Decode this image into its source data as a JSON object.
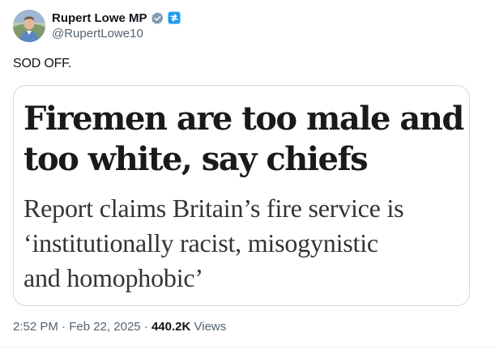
{
  "author": {
    "name": "Rupert Lowe MP",
    "handle": "@RupertLowe10",
    "verified_badge_color": "#829aab",
    "affiliate_badge_color": "#1d9bf0"
  },
  "tweet": {
    "text": "SOD OFF."
  },
  "media": {
    "headline_lines": [
      "Firemen are too male and",
      "too white, say chiefs"
    ],
    "standfirst_lines": [
      "Report claims Britain’s fire service is",
      "‘institutionally racist, misogynistic",
      "and homophobic’"
    ]
  },
  "meta": {
    "time": "2:52 PM",
    "separator": "·",
    "date": "Feb 22, 2025",
    "views_count": "440.2K",
    "views_label": "Views"
  },
  "colors": {
    "text_primary": "#0f1419",
    "text_secondary": "#536471",
    "border": "#cfd9de"
  }
}
